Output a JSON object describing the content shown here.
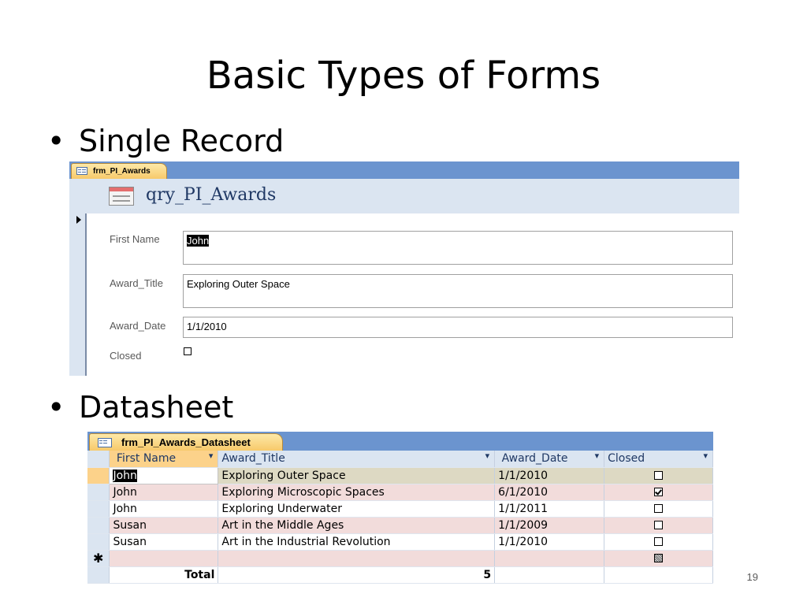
{
  "slide": {
    "title": "Basic Types of Forms",
    "bullets": [
      "Single Record",
      "Datasheet"
    ],
    "bullet_glyph": "•",
    "page_number": "19"
  },
  "single_form": {
    "tab_label": "frm_PI_Awards",
    "header_title": "qry_PI_Awards",
    "fields": {
      "first_name_label": "First Name",
      "first_name_value": "John",
      "award_title_label": "Award_Title",
      "award_title_value": "Exploring Outer Space",
      "award_date_label": "Award_Date",
      "award_date_value": "1/1/2010",
      "closed_label": "Closed",
      "closed_value": false
    }
  },
  "datasheet": {
    "tab_label": "frm_PI_Awards_Datasheet",
    "columns": [
      "First Name",
      "Award_Title",
      "Award_Date",
      "Closed"
    ],
    "rows": [
      {
        "first_name": "John",
        "award_title": "Exploring Outer Space",
        "award_date": "1/1/2010",
        "closed": false
      },
      {
        "first_name": "John",
        "award_title": "Exploring Microscopic Spaces",
        "award_date": "6/1/2010",
        "closed": true
      },
      {
        "first_name": "John",
        "award_title": "Exploring Underwater",
        "award_date": "1/1/2011",
        "closed": false
      },
      {
        "first_name": "Susan",
        "award_title": "Art in the Middle Ages",
        "award_date": "1/1/2009",
        "closed": false
      },
      {
        "first_name": "Susan",
        "award_title": "Art in the Industrial Revolution",
        "award_date": "1/1/2010",
        "closed": false
      }
    ],
    "new_row_marker": "✱",
    "total_label": "Total",
    "total_value": "5"
  }
}
